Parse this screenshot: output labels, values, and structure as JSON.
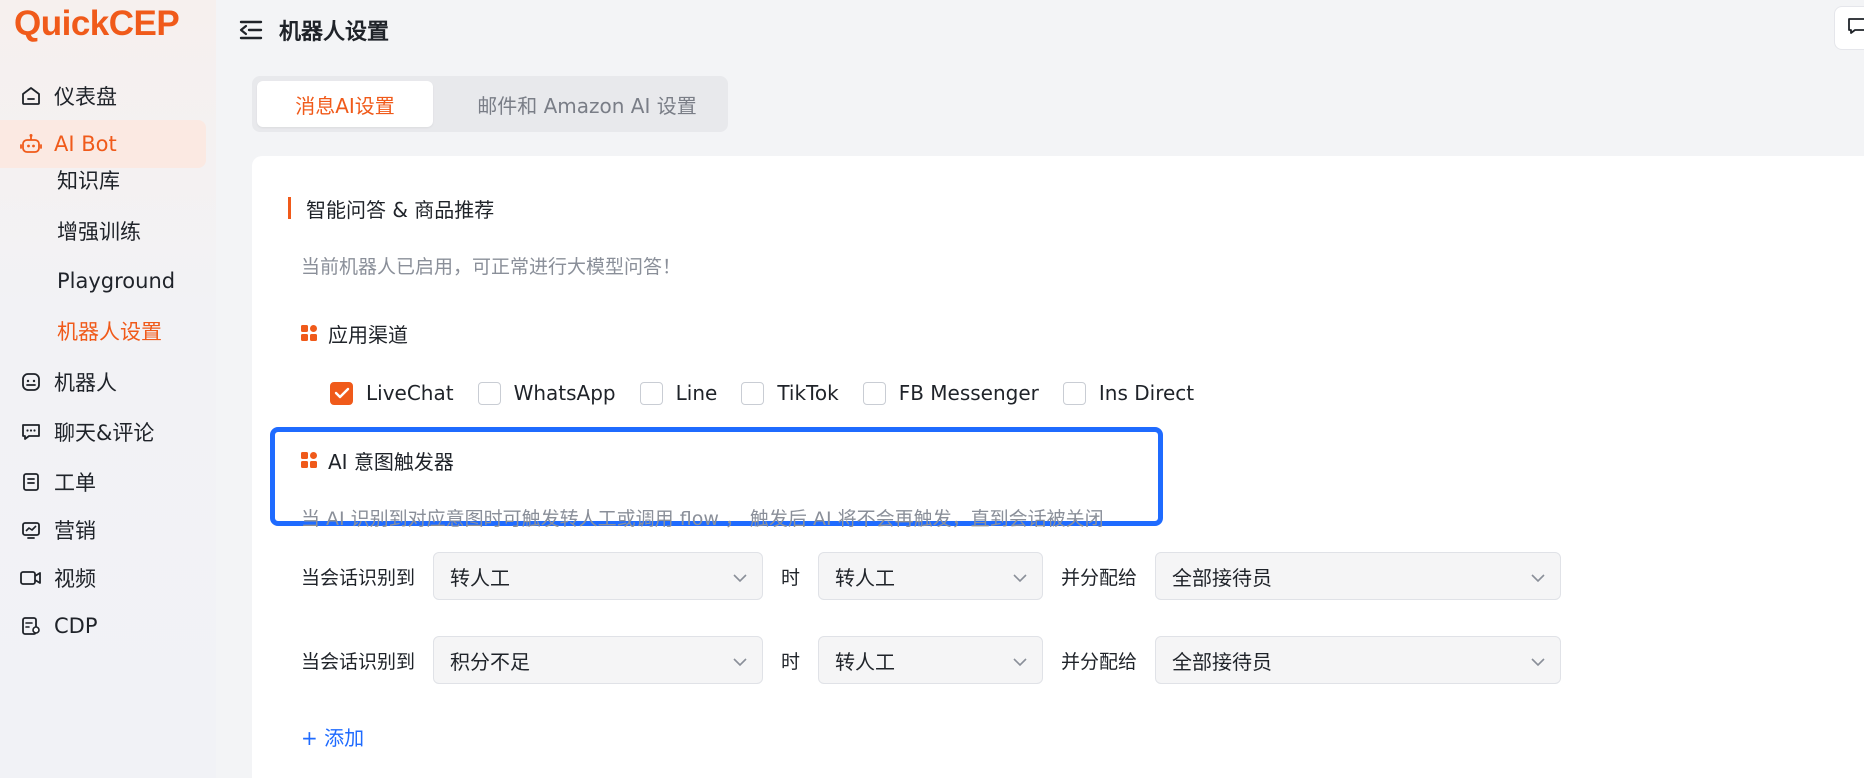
{
  "logo": {
    "text": "QuickCEP"
  },
  "sidebar": {
    "items": [
      {
        "label": "仪表盘",
        "icon": "home-icon"
      },
      {
        "label": "AI Bot",
        "icon": "robot-icon"
      },
      {
        "label": "机器人",
        "icon": "bot-face-icon"
      },
      {
        "label": "聊天&评论",
        "icon": "chat-icon"
      },
      {
        "label": "工单",
        "icon": "ticket-icon"
      },
      {
        "label": "营销",
        "icon": "marketing-icon"
      },
      {
        "label": "视频",
        "icon": "video-icon"
      },
      {
        "label": "CDP",
        "icon": "cdp-icon"
      }
    ],
    "sub_items": [
      {
        "label": "知识库"
      },
      {
        "label": "增强训练"
      },
      {
        "label": "Playground"
      },
      {
        "label": "机器人设置"
      }
    ]
  },
  "header": {
    "title": "机器人设置"
  },
  "tabs": [
    {
      "label": "消息AI设置",
      "active": true
    },
    {
      "label": "邮件和 Amazon AI 设置",
      "active": false
    }
  ],
  "main": {
    "section_title": "智能问答 & 商品推荐",
    "section_desc": "当前机器人已启用，可正常进行大模型问答！",
    "channels_title": "应用渠道",
    "channels": [
      {
        "label": "LiveChat",
        "checked": true
      },
      {
        "label": "WhatsApp",
        "checked": false
      },
      {
        "label": "Line",
        "checked": false
      },
      {
        "label": "TikTok",
        "checked": false
      },
      {
        "label": "FB Messenger",
        "checked": false
      },
      {
        "label": "Ins Direct",
        "checked": false
      }
    ],
    "trigger_title": "AI 意图触发器",
    "trigger_desc": "当 AI 识别到对应意图时可触发转人工或调用 flow ， 触发后 AI 将不会再触发，直到会话被关闭",
    "rules": [
      {
        "prefix": "当会话识别到",
        "intent": "转人工",
        "when": "时",
        "action": "转人工",
        "assign_label": "并分配给",
        "assignee": "全部接待员"
      },
      {
        "prefix": "当会话识别到",
        "intent": "积分不足",
        "when": "时",
        "action": "转人工",
        "assign_label": "并分配给",
        "assignee": "全部接待员"
      }
    ],
    "add_label": "+ 添加"
  },
  "colors": {
    "accent": "#f05a1a",
    "highlight": "#1f6bff",
    "link": "#1f6bff"
  }
}
